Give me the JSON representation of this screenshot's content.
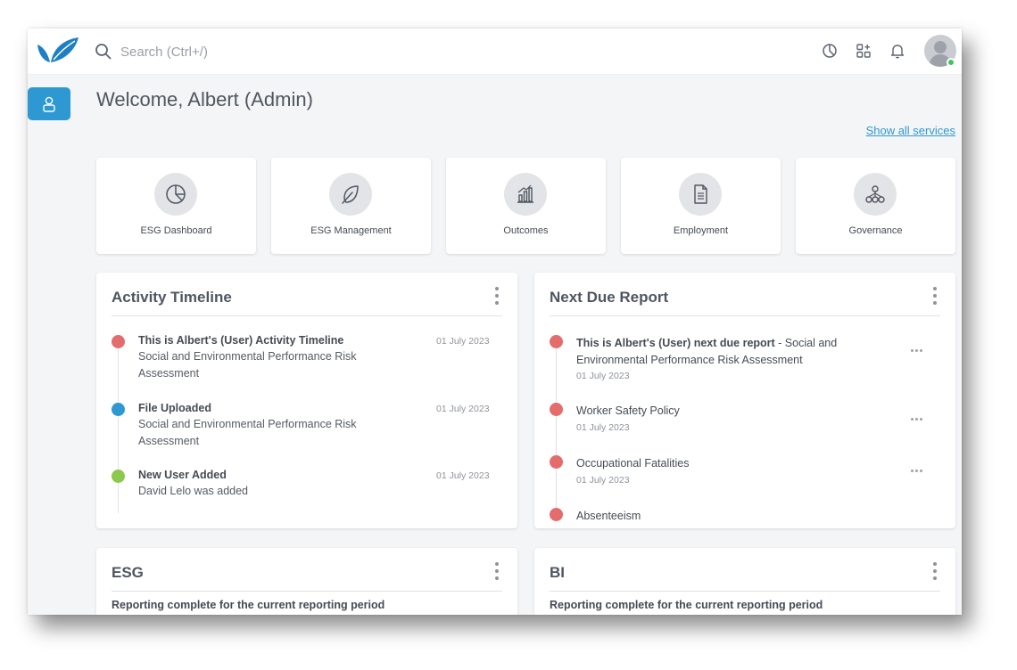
{
  "header": {
    "search_placeholder": "Search (Ctrl+/)"
  },
  "colors": {
    "accent": "#2e98d2",
    "logo": "#1f7fc4",
    "status_red": "#e46c6c",
    "status_blue": "#2e98d2",
    "status_green": "#8dc84e"
  },
  "icons": {
    "top": [
      "chart-pie-icon",
      "apps-icon",
      "bell-icon"
    ],
    "sidebar": "user-icon"
  },
  "page": {
    "title": "Welcome, Albert (Admin)",
    "show_all_services": "Show all services"
  },
  "services": [
    {
      "label": "ESG Dashboard",
      "icon": "chart-pie-icon"
    },
    {
      "label": "ESG Management",
      "icon": "leaf-icon"
    },
    {
      "label": "Outcomes",
      "icon": "bar-chart-icon"
    },
    {
      "label": "Employment",
      "icon": "document-icon"
    },
    {
      "label": "Governance",
      "icon": "org-chart-icon"
    }
  ],
  "activity": {
    "title": "Activity Timeline",
    "items": [
      {
        "title": "This is Albert's (User) Activity Timeline",
        "desc_line1": "Social and Environmental Performance Risk",
        "desc_line2": "Assessment",
        "date": "01 July 2023",
        "status": "red"
      },
      {
        "title": "File Uploaded",
        "desc_line1": "Social and Environmental Performance Risk",
        "desc_line2": "Assessment",
        "date": "01 July 2023",
        "status": "blue"
      },
      {
        "title": "New User Added",
        "desc_line1": "David Lelo was added",
        "desc_line2": "",
        "date": "01 July 2023",
        "status": "green"
      }
    ]
  },
  "next_due": {
    "title": "Next Due Report",
    "items": [
      {
        "title_bold": "This is Albert's (User) next due report",
        "title_rest": " - Social and Environmental Performance Risk Assessment",
        "date": "01 July 2023"
      },
      {
        "title_bold": "",
        "title_rest": "Worker Safety Policy",
        "date": "01 July 2023"
      },
      {
        "title_bold": "",
        "title_rest": "Occupational Fatalities",
        "date": "01 July 2023"
      },
      {
        "title_bold": "",
        "title_rest": "Absenteeism",
        "date": ""
      }
    ]
  },
  "esg": {
    "title": "ESG",
    "subtitle": "Reporting complete for the current reporting period"
  },
  "bi": {
    "title": "BI",
    "subtitle": "Reporting complete for the current reporting period"
  }
}
